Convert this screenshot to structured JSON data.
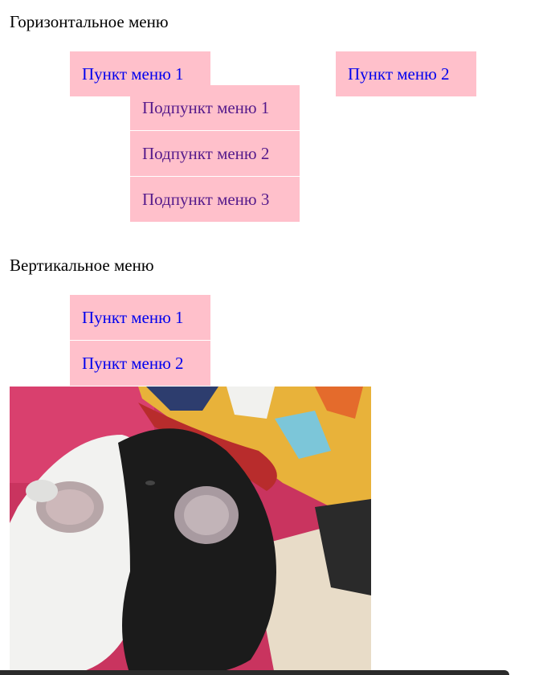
{
  "horizontal_menu": {
    "heading": "Горизонтальное меню",
    "items": [
      {
        "label": "Пункт меню 1",
        "submenu": [
          {
            "label": "Подпункт меню 1"
          },
          {
            "label": "Подпункт меню 2"
          },
          {
            "label": "Подпункт меню 3"
          }
        ]
      },
      {
        "label": "Пункт меню 2"
      }
    ]
  },
  "vertical_menu": {
    "heading": "Вертикальное меню",
    "items": [
      {
        "label": "Пункт меню 1"
      },
      {
        "label": "Пункт меню 2"
      }
    ]
  },
  "photo": {
    "subject": "chinchillas-photo"
  },
  "colors": {
    "menu_background": "#ffc0cb",
    "link": "#0000ee",
    "visited_link": "#551a8b"
  }
}
